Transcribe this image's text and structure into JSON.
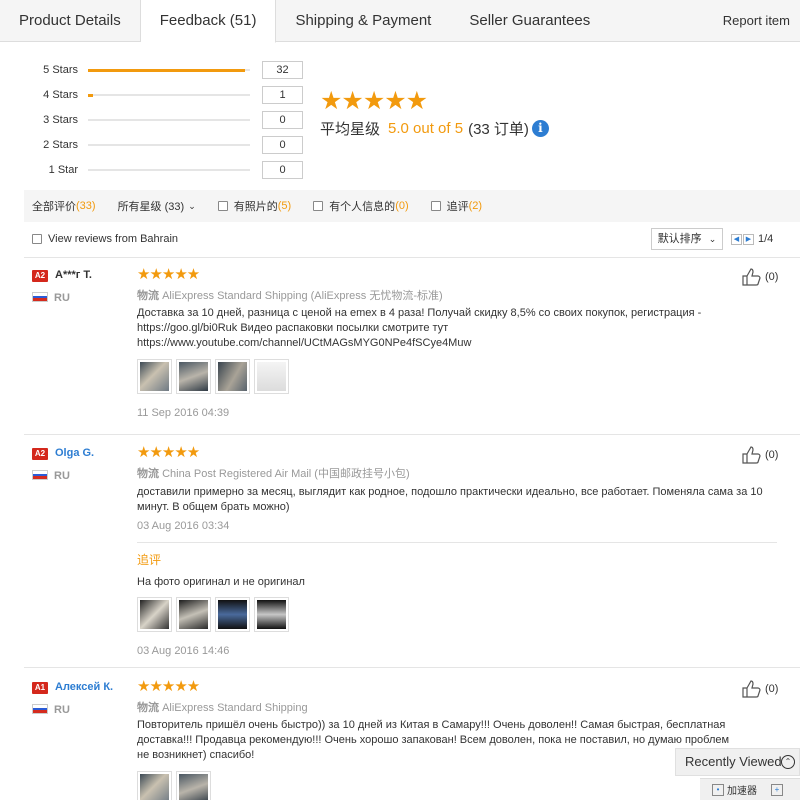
{
  "tabs": [
    {
      "label": "Product Details"
    },
    {
      "label": "Feedback (51)"
    },
    {
      "label": "Shipping & Payment"
    },
    {
      "label": "Seller Guarantees"
    }
  ],
  "report_label": "Report item",
  "distribution": [
    {
      "label": "5 Stars",
      "count": "32",
      "fraction": 0.97
    },
    {
      "label": "4 Stars",
      "count": "1",
      "fraction": 0.03
    },
    {
      "label": "3 Stars",
      "count": "0",
      "fraction": 0
    },
    {
      "label": "2 Stars",
      "count": "0",
      "fraction": 0
    },
    {
      "label": "1 Star",
      "count": "0",
      "fraction": 0
    }
  ],
  "summary": {
    "stars": "★★★★★",
    "avg_label": "平均星级",
    "score": "5.0 out of 5",
    "orders": "(33 订单)",
    "info_icon": "i"
  },
  "filters": {
    "all": {
      "label": "全部评价",
      "count": "(33)"
    },
    "stars": {
      "label": "所有星级 (33)"
    },
    "photos": {
      "label": "有照片的",
      "count": "(5)"
    },
    "personal": {
      "label": "有个人信息的",
      "count": "(0)"
    },
    "followup": {
      "label": "追评",
      "count": "(2)"
    }
  },
  "view_country": "View reviews from Bahrain",
  "sort_label": "默认排序",
  "pager": "1/4",
  "colors": {
    "accent": "#f29a0e",
    "link": "#2d7dd2",
    "level": "#d4281c"
  },
  "reviews": [
    {
      "level": "A2",
      "name": "A***г T.",
      "country": "RU",
      "stars": "★★★★★",
      "shipping_label": "物流",
      "shipping": "AliExpress Standard Shipping (AliExpress 无忧物流-标准)",
      "text": "Доставка за 10 дней, разница с ценой на emex в 4 раза! Получай скидку 8,5% со своих покупок, регистрация - https://goo.gl/bi0Ruk Видео распаковки посылки смотрите тут https://www.youtube.com/channel/UCtMAGsMYG0NPe4fSCye4Muw",
      "date": "11 Sep 2016 04:39",
      "likes": "(0)"
    },
    {
      "level": "A2",
      "name": "Olga G.",
      "country": "RU",
      "stars": "★★★★★",
      "shipping_label": "物流",
      "shipping": "China Post Registered Air Mail (中国邮政挂号小包)",
      "text": "доставили примерно за месяц, выглядит как родное, подошло практически идеально, все работает. Поменяла сама за 10 минут. В общем брать можно)",
      "date": "03 Aug 2016 03:34",
      "followup_label": "追评",
      "followup_text": "На фото оригинал и не оригинал",
      "followup_date": "03 Aug 2016 14:46",
      "likes": "(0)"
    },
    {
      "level": "A1",
      "name": "Алексей К.",
      "country": "RU",
      "stars": "★★★★★",
      "shipping_label": "物流",
      "shipping": "AliExpress Standard Shipping",
      "text": "Повторитель пришёл очень быстро)) за 10 дней из Китая в Самару!!! Очень доволен!! Самая быстрая, бесплатная доставка!!! Продавца рекомендую!!! Очень хорошо запакован! Всем доволен, пока не поставил, но думаю проблем не возникнет) спасибо!",
      "likes": "(0)"
    }
  ],
  "recently_viewed": "Recently Viewed",
  "bottom_bar": "加速器"
}
